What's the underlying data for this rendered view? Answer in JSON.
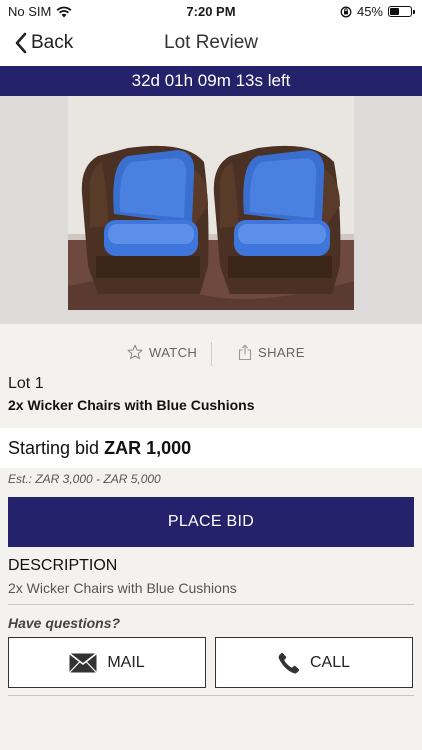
{
  "status_bar": {
    "carrier": "No SIM",
    "time": "7:20 PM",
    "battery_percent": "45%",
    "battery_level": 0.45
  },
  "nav": {
    "back_label": "Back",
    "title": "Lot Review"
  },
  "countdown": "32d 01h 09m 13s left",
  "actions": {
    "watch_label": "WATCH",
    "share_label": "SHARE"
  },
  "lot": {
    "number": "Lot 1",
    "title": "2x Wicker Chairs with Blue Cushions",
    "starting_bid_label": "Starting bid",
    "starting_bid_value": "ZAR 1,000",
    "estimate": "Est.: ZAR 3,000 - ZAR 5,000"
  },
  "place_bid_label": "PLACE BID",
  "description": {
    "heading": "DESCRIPTION",
    "text": "2x Wicker Chairs with Blue Cushions"
  },
  "questions_label": "Have questions?",
  "contact": {
    "mail_label": "MAIL",
    "call_label": "CALL"
  },
  "colors": {
    "brand_navy": "#24226b",
    "background": "#f4f2ef"
  }
}
